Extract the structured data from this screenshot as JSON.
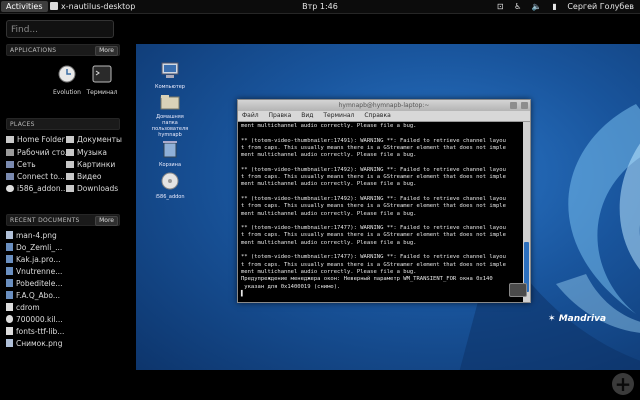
{
  "topbar": {
    "activities": "Activities",
    "app_title": "x-nautilus-desktop",
    "clock": "Втр  1:46",
    "user": "Сергей Голубев"
  },
  "sidebar": {
    "search_placeholder": "Find...",
    "applications": {
      "header": "APPLICATIONS",
      "more": "More",
      "apps": [
        "Evolution",
        "Терминал"
      ]
    },
    "places": {
      "header": "PLACES",
      "left": [
        "Home Folder",
        "Рабочий стол",
        "Сеть",
        "Connect to...",
        "i586_addon..."
      ],
      "right": [
        "Документы",
        "Музыка",
        "Картинки",
        "Видео",
        "Downloads"
      ]
    },
    "recent": {
      "header": "RECENT DOCUMENTS",
      "more": "More",
      "items": [
        "man-4.png",
        "Do_Zemli_...",
        "Kak.ja.pro...",
        "Vnutrenne...",
        "Pobeditele...",
        "F.A.Q_Abo...",
        "cdrom",
        "700000.kil...",
        "fonts-ttf-lib...",
        "Снимок.png"
      ]
    }
  },
  "desktop": {
    "icons": [
      "Компьютер",
      "Домашняя папка пользователя hymnapb",
      "Корзина",
      "i586_addon"
    ],
    "logo": "Mandriva"
  },
  "terminal": {
    "title": "hymnapb@hymnapb-laptop:~",
    "menu": [
      "Файл",
      "Правка",
      "Вид",
      "Терминал",
      "Справка"
    ],
    "lines": [
      "ment multichannel audio correctly. Please file a bug.",
      "",
      "** (totem-video-thumbnailer:17491): WARNING **: Failed to retrieve channel layou",
      "t from caps. This usually means there is a GStreamer element that does not imple",
      "ment multichannel audio correctly. Please file a bug.",
      "",
      "** (totem-video-thumbnailer:17492): WARNING **: Failed to retrieve channel layou",
      "t from caps. This usually means there is a GStreamer element that does not imple",
      "ment multichannel audio correctly. Please file a bug.",
      "",
      "** (totem-video-thumbnailer:17492): WARNING **: Failed to retrieve channel layou",
      "t from caps. This usually means there is a GStreamer element that does not imple",
      "ment multichannel audio correctly. Please file a bug.",
      "",
      "** (totem-video-thumbnailer:17477): WARNING **: Failed to retrieve channel layou",
      "t from caps. This usually means there is a GStreamer element that does not imple",
      "ment multichannel audio correctly. Please file a bug.",
      "",
      "** (totem-video-thumbnailer:17477): WARNING **: Failed to retrieve channel layou",
      "t from caps. This usually means there is a GStreamer element that does not imple",
      "ment multichannel audio correctly. Please file a bug.",
      "Предупреждение менеджера окон: Неверный параметр WM_TRANSIENT_FOR окна 0x140",
      " указан для 0x1400019 (снимо).",
      "▌"
    ]
  },
  "colors": {
    "desktop_blue": "#1f63b3",
    "panel_bg": "#0c0c0c",
    "scroll_thumb": "#2c6fbd"
  }
}
